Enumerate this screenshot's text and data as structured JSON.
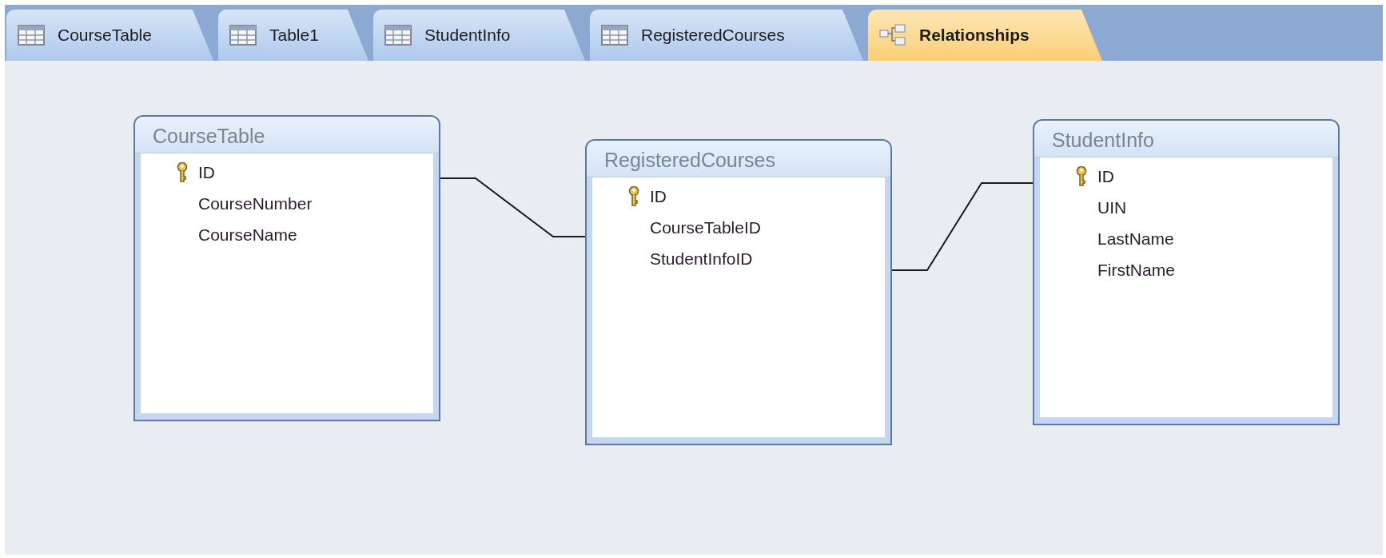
{
  "tabs": [
    {
      "label": "CourseTable",
      "kind": "table",
      "selected": false
    },
    {
      "label": "Table1",
      "kind": "table",
      "selected": false
    },
    {
      "label": "StudentInfo",
      "kind": "table",
      "selected": false
    },
    {
      "label": "RegisteredCourses",
      "kind": "table",
      "selected": false
    },
    {
      "label": "Relationships",
      "kind": "relationships",
      "selected": true
    }
  ],
  "tables": [
    {
      "title": "CourseTable",
      "fields": [
        {
          "name": "ID",
          "primary_key": true
        },
        {
          "name": "CourseNumber",
          "primary_key": false
        },
        {
          "name": "CourseName",
          "primary_key": false
        }
      ]
    },
    {
      "title": "RegisteredCourses",
      "fields": [
        {
          "name": "ID",
          "primary_key": true
        },
        {
          "name": "CourseTableID",
          "primary_key": false
        },
        {
          "name": "StudentInfoID",
          "primary_key": false
        }
      ]
    },
    {
      "title": "StudentInfo",
      "fields": [
        {
          "name": "ID",
          "primary_key": true
        },
        {
          "name": "UIN",
          "primary_key": false
        },
        {
          "name": "LastName",
          "primary_key": false
        },
        {
          "name": "FirstName",
          "primary_key": false
        }
      ]
    }
  ]
}
